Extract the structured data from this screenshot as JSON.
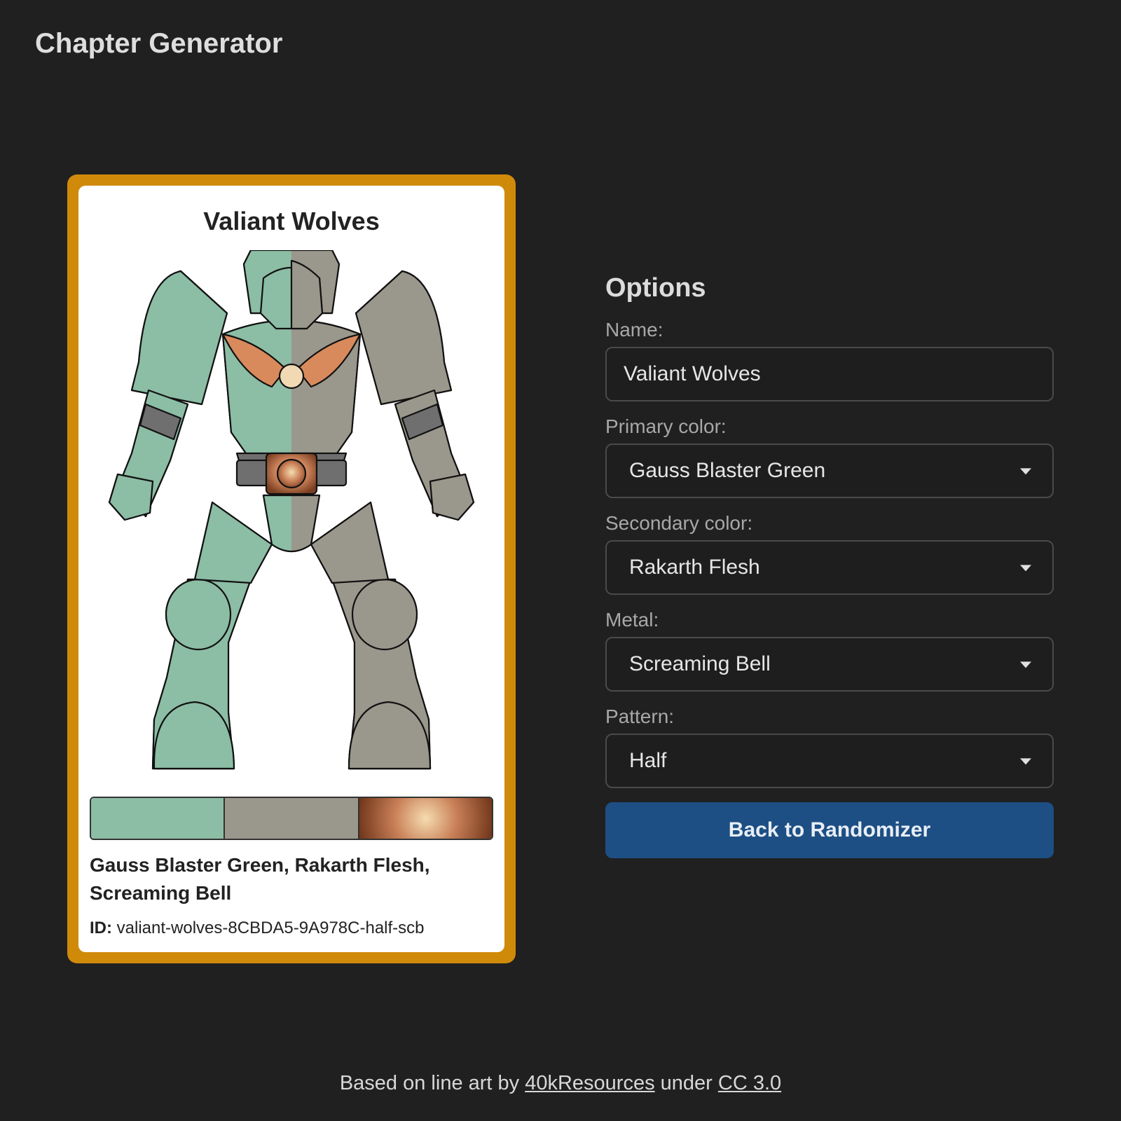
{
  "header": {
    "title": "Chapter Generator"
  },
  "card": {
    "name": "Valiant Wolves",
    "paint_names": "Gauss Blaster Green, Rakarth Flesh, Screaming Bell",
    "id_label": "ID:",
    "id_value": "valiant-wolves-8CBDA5-9A978C-half-scb",
    "frame_color": "#d08a0a",
    "swatches": [
      {
        "name": "Gauss Blaster Green",
        "color": "#8cbda5"
      },
      {
        "name": "Rakarth Flesh",
        "color": "#9a978c"
      },
      {
        "name": "Screaming Bell",
        "color": "#c08050"
      }
    ]
  },
  "options": {
    "heading": "Options",
    "name_label": "Name:",
    "name_value": "Valiant Wolves",
    "primary_label": "Primary color:",
    "primary_value": "Gauss Blaster Green",
    "secondary_label": "Secondary color:",
    "secondary_value": "Rakarth Flesh",
    "metal_label": "Metal:",
    "metal_value": "Screaming Bell",
    "pattern_label": "Pattern:",
    "pattern_value": "Half",
    "back_button": "Back to Randomizer"
  },
  "footer": {
    "prefix": "Based on line art by",
    "link1": "40kResources",
    "middle": "under",
    "link2": "CC 3.0"
  }
}
